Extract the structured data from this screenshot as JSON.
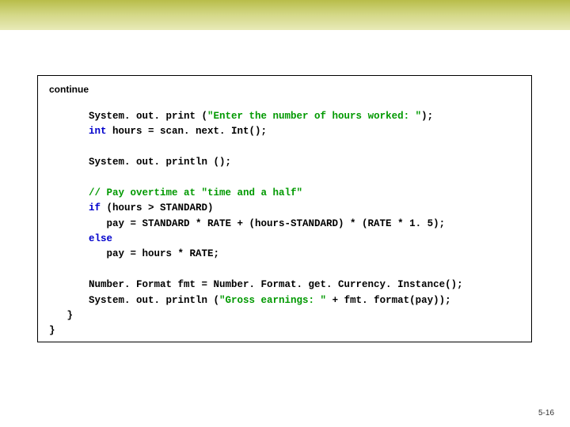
{
  "header": {
    "continue_label": "continue"
  },
  "code": {
    "l1a": "System. out. print (",
    "l1s": "\"Enter the number of hours worked: \"",
    "l1b": ");",
    "l2k": "int",
    "l2r": " hours = scan. next. Int();",
    "l3": "System. out. println ();",
    "l4c": "// Pay overtime at \"time and a half\"",
    "l5k": "if",
    "l5r": " (hours > STANDARD)",
    "l6": "   pay = STANDARD * RATE + (hours-STANDARD) * (RATE * 1. 5);",
    "l7k": "else",
    "l8": "   pay = hours * RATE;",
    "l9": "Number. Format fmt = Number. Format. get. Currency. Instance();",
    "l10a": "System. out. println (",
    "l10s": "\"Gross earnings: \"",
    "l10b": " + fmt. format(pay));",
    "close1": "   }",
    "close2": "}"
  },
  "footer": {
    "page": "5-16"
  }
}
